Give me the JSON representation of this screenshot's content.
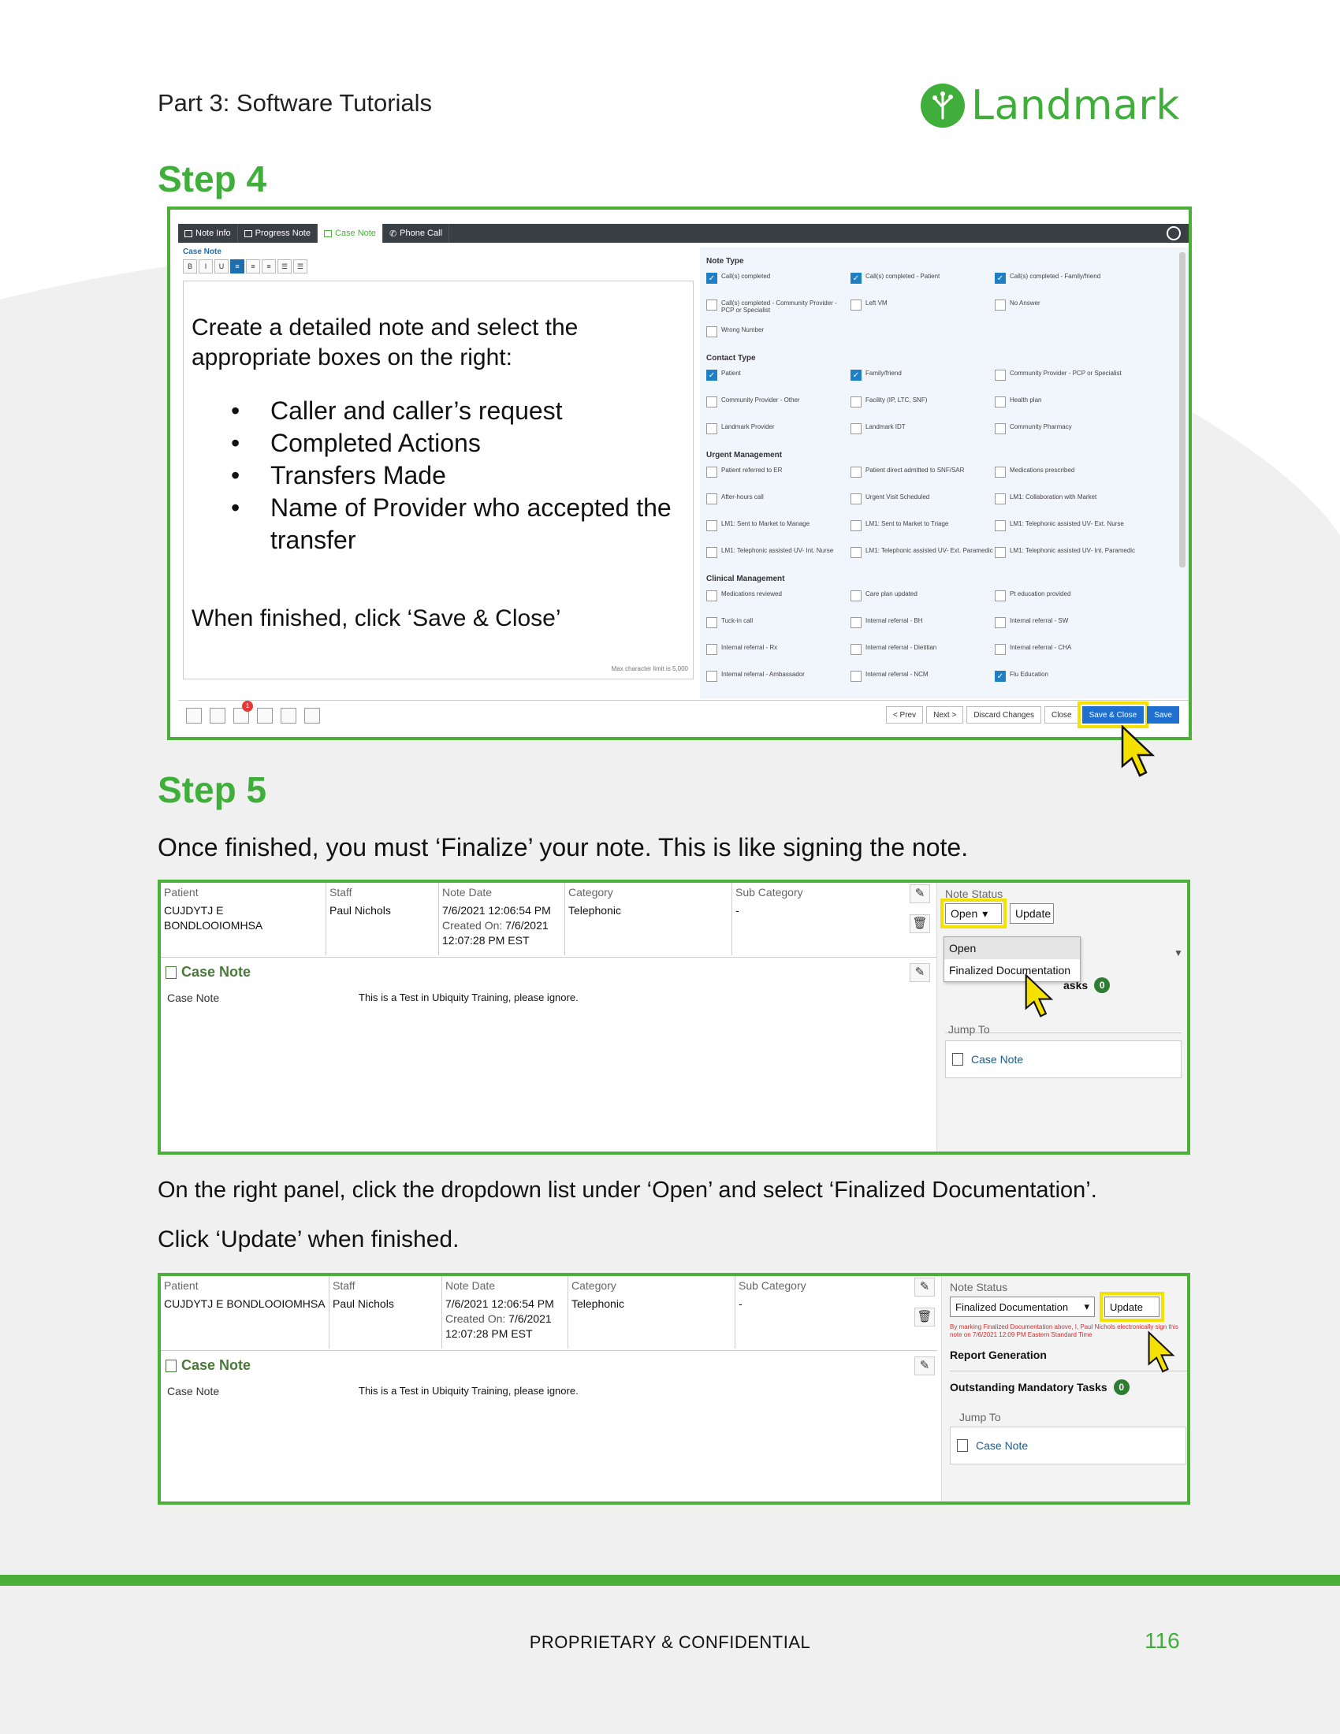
{
  "header": {
    "section_title": "Part 3: Software Tutorials",
    "logo_text": "Landmark"
  },
  "step4": {
    "heading": "Step 4",
    "tabs": [
      "Note Info",
      "Progress Note",
      "Case Note",
      "Phone Call"
    ],
    "editor_title": "Case Note",
    "toolbar": [
      "B",
      "I",
      "U",
      "≡",
      "≡",
      "≡",
      "☰",
      "☰"
    ],
    "instruction_intro": "Create a detailed note and select the appropriate boxes on the right:",
    "bullets": [
      "Caller and caller’s request",
      "Completed Actions",
      "Transfers Made",
      "Name of Provider who accepted the transfer"
    ],
    "instruction_finish": "When finished, click ‘Save & Close’",
    "char_limit": "Max character limit is 5,000",
    "sections": [
      {
        "title": "Note Type",
        "items": [
          {
            "label": "Call(s) completed",
            "checked": true
          },
          {
            "label": "Call(s) completed - Patient",
            "checked": true
          },
          {
            "label": "Call(s) completed - Family/friend",
            "checked": true
          },
          {
            "label": "Call(s) completed - Community Provider - PCP or Specialist",
            "checked": false
          },
          {
            "label": "Left VM",
            "checked": false
          },
          {
            "label": "No Answer",
            "checked": false
          },
          {
            "label": "Wrong Number",
            "checked": false
          }
        ]
      },
      {
        "title": "Contact Type",
        "items": [
          {
            "label": "Patient",
            "checked": true
          },
          {
            "label": "Family/friend",
            "checked": true
          },
          {
            "label": "Community Provider - PCP or Specialist",
            "checked": false
          },
          {
            "label": "Community Provider - Other",
            "checked": false
          },
          {
            "label": "Facility (IP, LTC, SNF)",
            "checked": false
          },
          {
            "label": "Health plan",
            "checked": false
          },
          {
            "label": "Landmark Provider",
            "checked": false
          },
          {
            "label": "Landmark IDT",
            "checked": false
          },
          {
            "label": "Community Pharmacy",
            "checked": false
          }
        ]
      },
      {
        "title": "Urgent Management",
        "items": [
          {
            "label": "Patient referred to ER",
            "checked": false
          },
          {
            "label": "Patient direct admitted to SNF/SAR",
            "checked": false
          },
          {
            "label": "Medications prescribed",
            "checked": false
          },
          {
            "label": "After-hours call",
            "checked": false
          },
          {
            "label": "Urgent Visit Scheduled",
            "checked": false
          },
          {
            "label": "LM1: Collaboration with Market",
            "checked": false
          },
          {
            "label": "LM1: Sent to Market to Manage",
            "checked": false
          },
          {
            "label": "LM1: Sent to Market to Triage",
            "checked": false
          },
          {
            "label": "LM1: Telephonic assisted UV- Ext. Nurse",
            "checked": false
          },
          {
            "label": "LM1: Telephonic assisted UV- Int. Nurse",
            "checked": false
          },
          {
            "label": "LM1: Telephonic assisted UV- Ext. Paramedic",
            "checked": false
          },
          {
            "label": "LM1: Telephonic assisted UV- Int. Paramedic",
            "checked": false
          }
        ]
      },
      {
        "title": "Clinical Management",
        "items": [
          {
            "label": "Medications reviewed",
            "checked": false
          },
          {
            "label": "Care plan updated",
            "checked": false
          },
          {
            "label": "Pt education provided",
            "checked": false
          },
          {
            "label": "Tuck-in call",
            "checked": false
          },
          {
            "label": "Internal referral - BH",
            "checked": false
          },
          {
            "label": "Internal referral - SW",
            "checked": false
          },
          {
            "label": "Internal referral - Rx",
            "checked": false
          },
          {
            "label": "Internal referral - Dietitian",
            "checked": false
          },
          {
            "label": "Internal referral - CHA",
            "checked": false
          },
          {
            "label": "Internal referral - Ambassador",
            "checked": false
          },
          {
            "label": "Internal referral - NCM",
            "checked": false
          },
          {
            "label": "Flu Education",
            "checked": true
          }
        ]
      }
    ],
    "buttons": {
      "prev": "< Prev",
      "next": "Next >",
      "discard": "Discard Changes",
      "close": "Close",
      "save_close": "Save & Close",
      "save": "Save"
    },
    "alert_count": "1"
  },
  "step5": {
    "heading": "Step 5",
    "intro": "Once finished, you must ‘Finalize’ your note. This is like signing the note.",
    "instruction1": "On the right panel, click the dropdown list under ‘Open’ and select ‘Finalized Documentation’.",
    "instruction2": "Click ‘Update’ when finished.",
    "table": {
      "patient_label": "Patient",
      "patient": "CUJDYTJ E BONDLOOIOMHSA",
      "staff_label": "Staff",
      "staff": "Paul Nichols",
      "date_label": "Note Date",
      "date": "7/6/2021 12:06:54 PM",
      "created_label": "Created On:",
      "created": "7/6/2021",
      "created_time": "12:07:28 PM EST",
      "category_label": "Category",
      "category": "Telephonic",
      "subcategory_label": "Sub Category",
      "subcategory": "-"
    },
    "case_note": {
      "title": "Case Note",
      "row_label": "Case Note",
      "row_value": "This is a Test in Ubiquity Training, please ignore."
    },
    "panel": {
      "status_label": "Note Status",
      "status_open": "Open",
      "status_finalized": "Finalized Documentation",
      "update": "Update",
      "options": [
        "Open",
        "Finalized Documentation"
      ],
      "tasks_fragment": "asks",
      "tasks_count": "0",
      "jump_to": "Jump To",
      "jump_item": "Case Note",
      "sign_text": "By marking Finalized Documentation above, I, Paul Nichols electronically sign this note on 7/6/2021 12:09 PM Eastern Standard Time",
      "report_generation": "Report Generation",
      "outstanding_tasks": "Outstanding Mandatory Tasks"
    }
  },
  "footer": {
    "confidential": "PROPRIETARY & CONFIDENTIAL",
    "page_number": "116"
  }
}
